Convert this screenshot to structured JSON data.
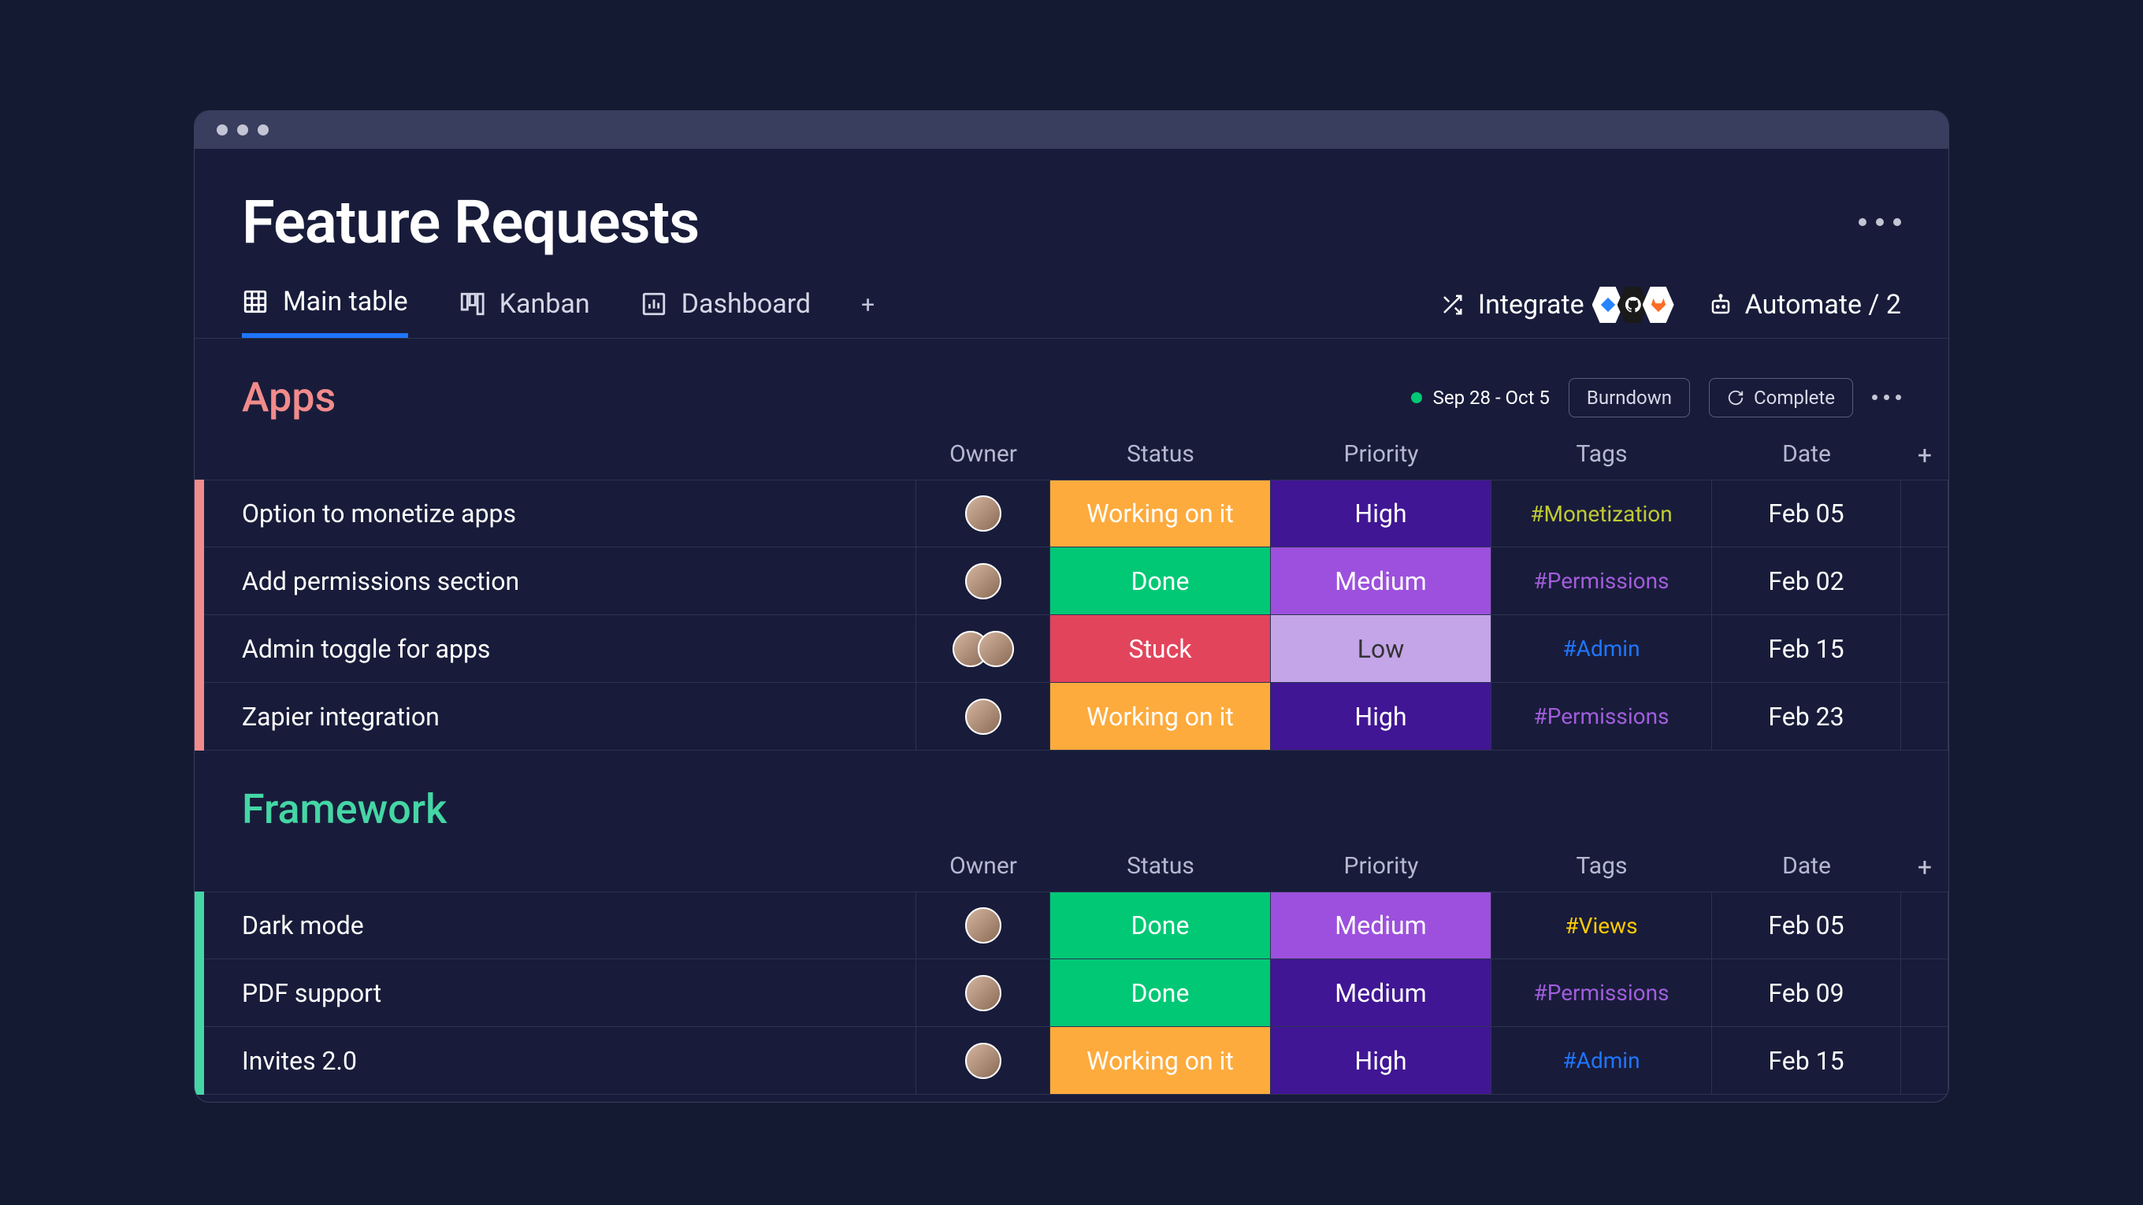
{
  "page": {
    "title": "Feature Requests"
  },
  "tabs": [
    {
      "label": "Main table",
      "active": true,
      "icon": "table"
    },
    {
      "label": "Kanban",
      "active": false,
      "icon": "kanban"
    },
    {
      "label": "Dashboard",
      "active": false,
      "icon": "chart"
    }
  ],
  "toolbar": {
    "integrate_label": "Integrate",
    "automate_label": "Automate / 2"
  },
  "columns": [
    "Owner",
    "Status",
    "Priority",
    "Tags",
    "Date"
  ],
  "groups": [
    {
      "name": "Apps",
      "color": "#f28b8b",
      "sprint": "Sep 28 - Oct 5",
      "controls": {
        "burndown": "Burndown",
        "complete": "Complete"
      },
      "rows": [
        {
          "name": "Option to monetize apps",
          "owner_count": 1,
          "status": "Working on it",
          "status_color": "#fdab3d",
          "priority": "High",
          "priority_color": "#401694",
          "tag": "#Monetization",
          "tag_color": "#c0ca33",
          "date": "Feb 05"
        },
        {
          "name": "Add permissions section",
          "owner_count": 1,
          "status": "Done",
          "status_color": "#00c875",
          "priority": "Medium",
          "priority_color": "#9d50dd",
          "tag": "#Permissions",
          "tag_color": "#a25ddc",
          "date": "Feb 02"
        },
        {
          "name": "Admin toggle for apps",
          "owner_count": 2,
          "status": "Stuck",
          "status_color": "#e2445c",
          "priority": "Low",
          "priority_color": "#c4a5e8",
          "tag": "#Admin",
          "tag_color": "#1f76ff",
          "date": "Feb 15"
        },
        {
          "name": "Zapier integration",
          "owner_count": 1,
          "status": "Working on it",
          "status_color": "#fdab3d",
          "priority": "High",
          "priority_color": "#401694",
          "tag": "#Permissions",
          "tag_color": "#a25ddc",
          "date": "Feb 23"
        }
      ]
    },
    {
      "name": "Framework",
      "color": "#45d6a5",
      "rows": [
        {
          "name": "Dark mode",
          "owner_count": 1,
          "status": "Done",
          "status_color": "#00c875",
          "priority": "Medium",
          "priority_color": "#9d50dd",
          "tag": "#Views",
          "tag_color": "#ffcb00",
          "date": "Feb 05"
        },
        {
          "name": "PDF support",
          "owner_count": 1,
          "status": "Done",
          "status_color": "#00c875",
          "priority": "Medium",
          "priority_color": "#401694",
          "tag": "#Permissions",
          "tag_color": "#a25ddc",
          "date": "Feb 09"
        },
        {
          "name": "Invites 2.0",
          "owner_count": 1,
          "status": "Working on it",
          "status_color": "#fdab3d",
          "priority": "High",
          "priority_color": "#401694",
          "tag": "#Admin",
          "tag_color": "#1f76ff",
          "date": "Feb 15"
        }
      ]
    }
  ]
}
